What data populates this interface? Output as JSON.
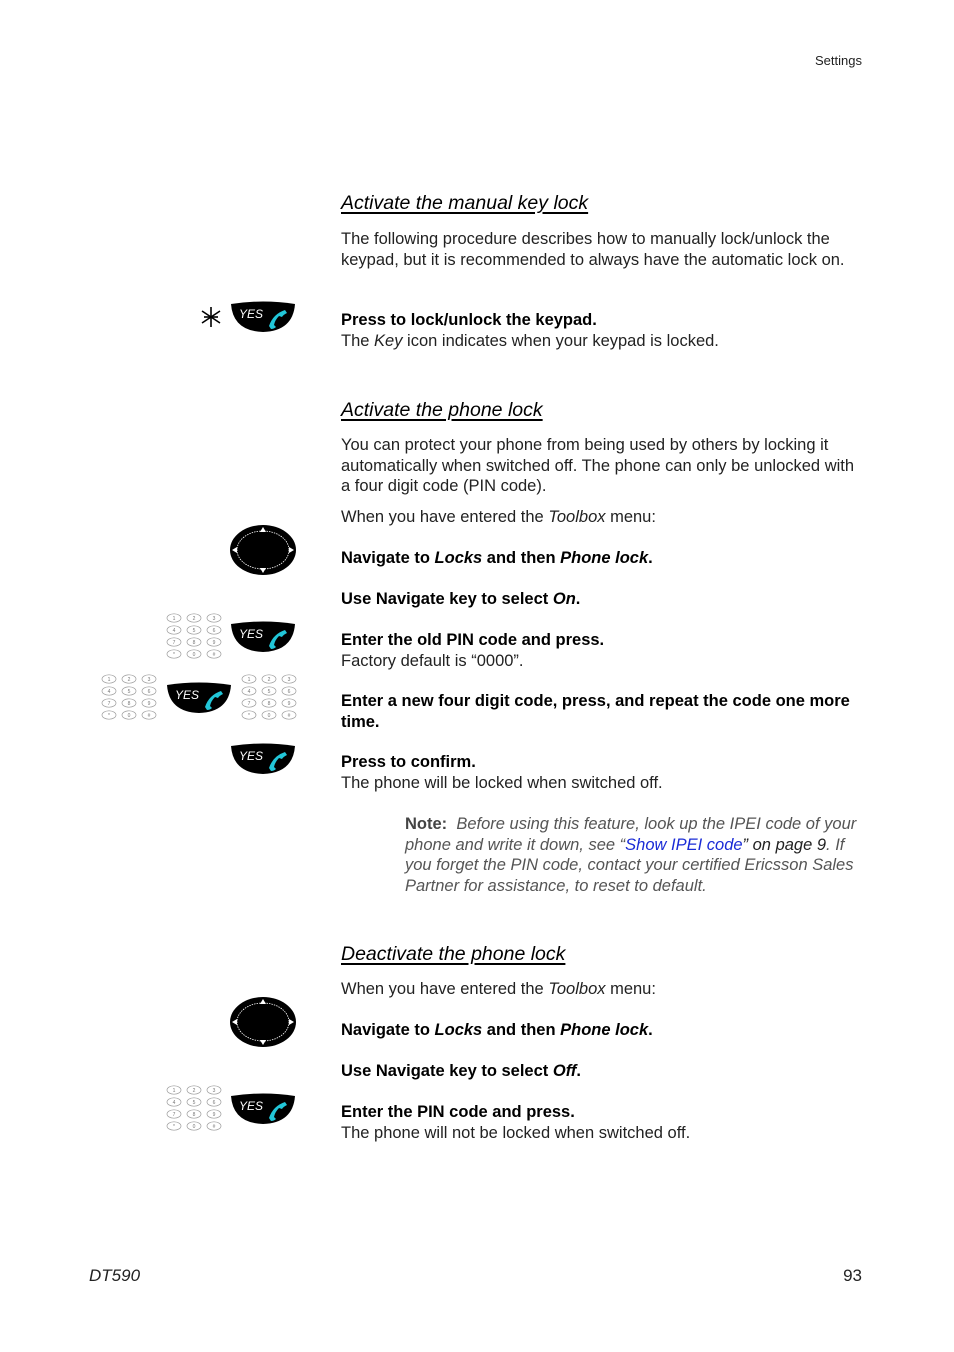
{
  "header": {
    "section": "Settings"
  },
  "footer": {
    "product": "DT590",
    "page_number": "93"
  },
  "sections": [
    {
      "title": "Activate the manual key lock",
      "intro": "The following procedure describes how to manually lock/unlock the keypad, but it is recommended to always have the automatic lock on.",
      "steps": [
        {
          "icons": [
            "star-key-icon",
            "yes-key-icon"
          ],
          "instruction": "Press to lock/unlock the keypad.",
          "detail_pre": "The ",
          "detail_em": "Key",
          "detail_post": " icon indicates when your keypad is locked."
        }
      ]
    },
    {
      "title": "Activate the phone lock",
      "intro": "You can protect your phone from being used by others by locking it automatically when switched off. The phone can only be unlocked with a four digit code (PIN code).",
      "context_pre": "When you have entered the ",
      "context_em": "Toolbox",
      "context_post": " menu:",
      "steps": [
        {
          "icons": [
            "navigation-key-icon"
          ],
          "i_pre": "Navigate to ",
          "i_em1": "Locks",
          "i_mid": " and then ",
          "i_em2": "Phone lock",
          "i_post": "."
        },
        {
          "icons": [],
          "i_pre": "Use Navigate key to select ",
          "i_em1": "On",
          "i_post": "."
        },
        {
          "icons": [
            "keypad-icon",
            "yes-key-icon"
          ],
          "instruction": "Enter the old PIN code and press.",
          "detail": "Factory default is “0000”."
        },
        {
          "icons": [
            "keypad-icon",
            "yes-key-icon",
            "keypad-icon"
          ],
          "instruction": "Enter a new four digit code, press, and repeat the code one more time."
        },
        {
          "icons": [
            "yes-key-icon"
          ],
          "instruction": "Press to confirm.",
          "detail": "The phone will be locked when switched off."
        }
      ],
      "note": {
        "label": "Note:",
        "text1": "Before using this feature, look up the IPEI code of your phone and write it down, see “",
        "link": "Show IPEI code",
        "text2": "” on page 9",
        "text3": ". If you forget the PIN code, contact your certified Ericsson Sales Partner for assistance, to reset to default."
      }
    },
    {
      "title": "Deactivate the phone lock",
      "context_pre": "When you have entered the ",
      "context_em": "Toolbox",
      "context_post": " menu:",
      "steps": [
        {
          "icons": [
            "navigation-key-icon"
          ],
          "i_pre": "Navigate to ",
          "i_em1": "Locks",
          "i_mid": " and then ",
          "i_em2": "Phone lock",
          "i_post": "."
        },
        {
          "icons": [],
          "i_pre": "Use Navigate key to select ",
          "i_em1": "Off",
          "i_post": "."
        },
        {
          "icons": [
            "keypad-icon",
            "yes-key-icon"
          ],
          "instruction": "Enter the PIN code and press.",
          "detail": "The phone will not be locked when switched off."
        }
      ]
    }
  ],
  "icon_labels": {
    "yes_key": "YES"
  },
  "colors": {
    "link": "#1a2bd6",
    "handset": "#22c6d8",
    "key_fill": "#000000"
  }
}
